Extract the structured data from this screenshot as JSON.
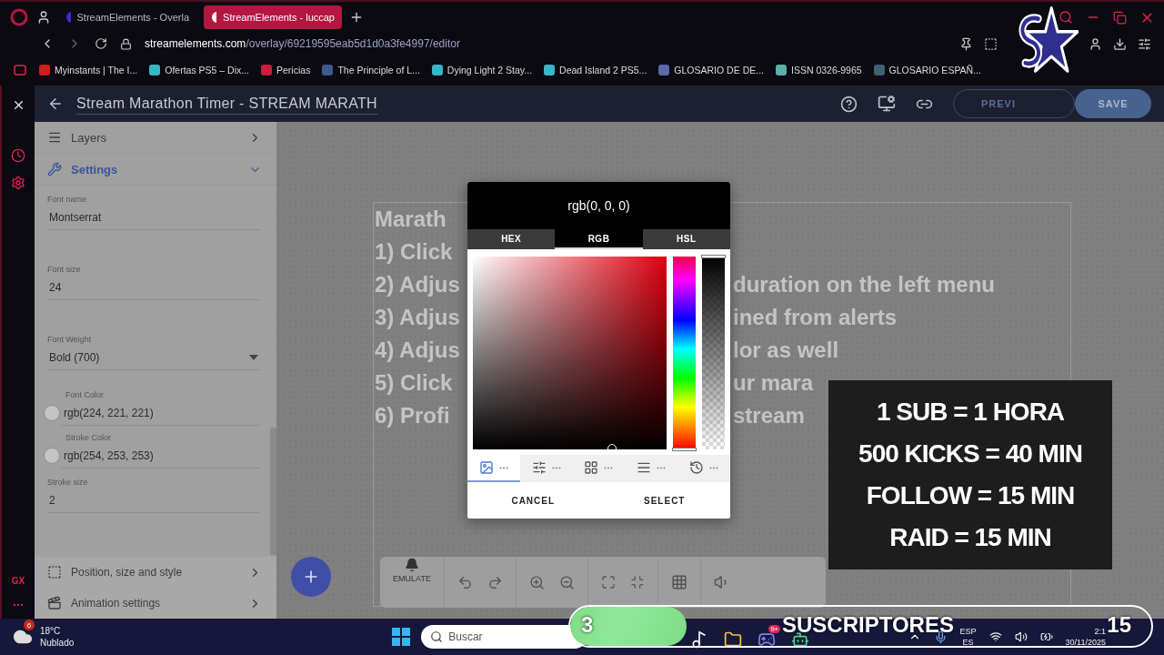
{
  "browser": {
    "tabs": [
      {
        "title": "StreamElements - Overla",
        "selected": false
      },
      {
        "title": "StreamElements - luccap",
        "selected": true
      }
    ],
    "address": {
      "domain": "streamelements.com",
      "path": "/overlay/69219595eab5d1d0a3fe4997/editor"
    },
    "bookmarks": [
      "Myinstants | The I...",
      "Ofertas PS5 – Dix...",
      "Pericias",
      "The Principle of L...",
      "Dying Light 2 Stay...",
      "Dead Island 2 PS5...",
      "GLOSARIO DE DE...",
      "ISSN 0326-9965",
      "GLOSARIO ESPAÑ..."
    ],
    "sidebar_badge": "GX"
  },
  "editor": {
    "title": "Stream Marathon Timer - STREAM MARATH",
    "buttons": [
      {
        "label": "PREVI",
        "kind": "outline"
      },
      {
        "label": "SAVE",
        "kind": "filled"
      }
    ]
  },
  "panel": {
    "sections": [
      {
        "label": "Layers",
        "expanded": false
      },
      {
        "label": "Settings",
        "expanded": true
      }
    ],
    "fields": [
      {
        "kind": "text",
        "label": "Font name",
        "value": "Montserrat"
      },
      {
        "kind": "text",
        "label": "Font size",
        "value": "24"
      },
      {
        "kind": "select",
        "label": "Font Weight",
        "value": "Bold (700)"
      },
      {
        "kind": "color",
        "label": "Font Color",
        "value": "rgb(224, 221, 221)"
      },
      {
        "kind": "color",
        "label": "Stroke Color",
        "value": "rgb(254, 253, 253)"
      },
      {
        "kind": "text",
        "label": "Stroke size",
        "value": "2"
      }
    ],
    "footer_sections": [
      {
        "label": "Position, size and style",
        "kind": "position"
      },
      {
        "label": "Animation settings",
        "kind": "animation"
      }
    ]
  },
  "canvas": {
    "lines": [
      {
        "left": "Marath"
      },
      {
        "left": "1) Click"
      },
      {
        "left": "2) Adjus",
        "right": "duration on the left menu"
      },
      {
        "left": "3) Adjus",
        "right": "ined from alerts"
      },
      {
        "left": "4) Adjus",
        "right": "lor as well"
      },
      {
        "left": "5) Click",
        "right": "ur mara"
      },
      {
        "left": "6) Profi",
        "right": "stream"
      }
    ],
    "emulate": "EMULATE"
  },
  "color_picker": {
    "value": "rgb(0, 0, 0)",
    "hue": {
      "level": 0
    },
    "alpha": {
      "level": 1
    },
    "modes": [
      {
        "label": "HEX",
        "selected": false
      },
      {
        "label": "RGB",
        "selected": true
      },
      {
        "label": "HSL",
        "selected": false
      }
    ],
    "palette_tabs": [
      {
        "kind": "picker",
        "selected": true
      },
      {
        "kind": "sliders",
        "selected": false
      },
      {
        "kind": "grid",
        "selected": false
      },
      {
        "kind": "list",
        "selected": false
      },
      {
        "kind": "history",
        "selected": false
      }
    ],
    "actions": [
      "CANCEL",
      "SELECT"
    ]
  },
  "stream_overlay": {
    "rates": [
      "1 SUB =  1 HORA",
      "500 KICKS = 40 MIN",
      "FOLLOW = 15 MIN",
      "RAID = 15 MIN"
    ],
    "goal": {
      "current": "3",
      "label": "SUSCRIPTORES",
      "target": "15",
      "level": 0.2
    }
  },
  "taskbar": {
    "weather": {
      "badge": "6",
      "temperature": "18°C",
      "condition": "Nublado"
    },
    "search": {
      "placeholder": "Buscar"
    },
    "apps": [
      {
        "kind": "tiktok"
      },
      {
        "kind": "folder"
      },
      {
        "kind": "discord",
        "badge": "9+"
      },
      {
        "kind": "bot"
      }
    ],
    "language": [
      "ESP",
      "ES"
    ],
    "time": "2:1",
    "date": "30/11/2025"
  }
}
